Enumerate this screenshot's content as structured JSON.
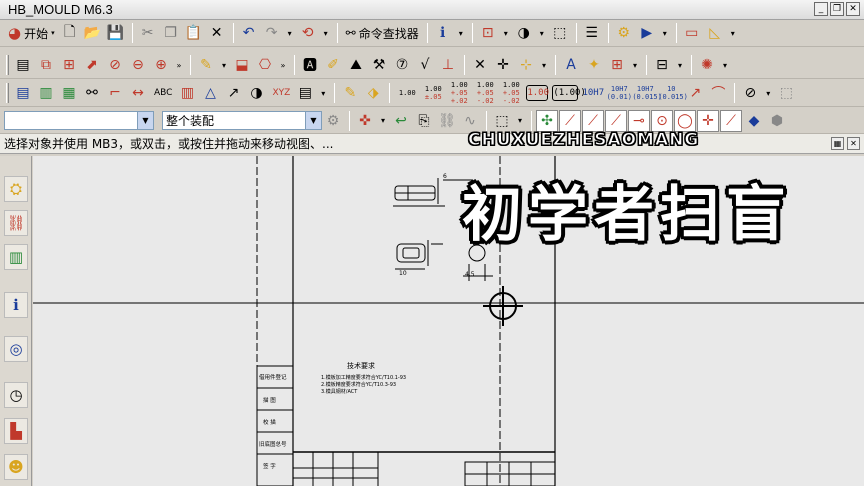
{
  "window": {
    "title": "HB_MOULD M6.3",
    "buttons": [
      "_",
      "❐",
      "✕"
    ]
  },
  "toolbar1": {
    "start_label": "开始",
    "command_finder_label": "命令查找器"
  },
  "toolbar3": {
    "tolerances": [
      {
        "top": "1.00",
        "bottom": ""
      },
      {
        "top": "1.00",
        "bottom": "±.05"
      },
      {
        "top": "1.00",
        "bottom": "+.05 +.02"
      },
      {
        "top": "1.00",
        "bottom": "+.05 -.02"
      },
      {
        "top": "1.00",
        "bottom": "+.05 -.02"
      },
      {
        "top": "1.00",
        "bottom": ""
      },
      {
        "top": "(1.00)",
        "bottom": ""
      },
      {
        "top": "10H7",
        "bottom": ""
      },
      {
        "top": "10H7",
        "bottom": "(0.01)"
      },
      {
        "top": "10H7",
        "bottom": "(0.015)"
      },
      {
        "top": "10",
        "bottom": "(0.015)"
      }
    ],
    "abc_label": "ABC",
    "xyz_label": "XYZ"
  },
  "toolbar4": {
    "type_filter_value": "",
    "assembly_filter_value": "整个装配"
  },
  "prompt": {
    "text": "选择对象并使用 MB3，或双击，或按住并拖动来移动视图、..."
  },
  "overlay": {
    "watermark_text": "CHUXUEZHESAOMANG",
    "caption_text": "初学者扫盲"
  },
  "drawing": {
    "tech_req_title": "技术要求",
    "tech_req_lines": [
      "1.模板加工精度要求符合YC/T10.1-93",
      "2.模板精度要求符合YC/T10.3-93",
      "3.模具钢材/ACT"
    ],
    "title_block_rows": [
      "借用件登记",
      "描 图",
      "校 描",
      "旧底图总号",
      "签 字"
    ],
    "dims": [
      "6",
      "10",
      "4.5"
    ]
  },
  "colors": {
    "accent": "#1a3c9a",
    "canvas_bg": "#e9e9e9"
  }
}
